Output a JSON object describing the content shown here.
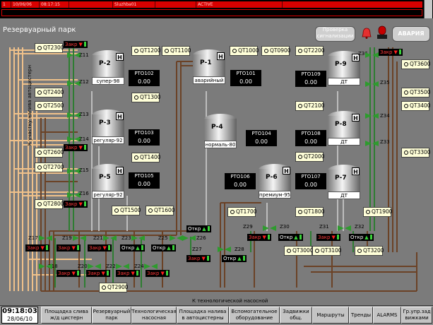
{
  "alarm_bar": {
    "row": [
      "1",
      "10/06/06",
      "08:17:15",
      "",
      "Sluzhba01",
      "",
      "ACTIVE",
      ""
    ]
  },
  "title": "Резервуарный парк",
  "buttons": {
    "reset": "Проверка сигнализации",
    "alarm": "АВАРИЯ"
  },
  "side_label": "К участку налива автоцистерн",
  "bottom_label": "К технологической насосной",
  "tanks": [
    {
      "name": "Р-2",
      "label": "супер-98"
    },
    {
      "name": "Р-3",
      "label": "регуляр-92"
    },
    {
      "name": "Р-5",
      "label": "регуляр-92"
    },
    {
      "name": "Р-1",
      "label": "аварийный"
    },
    {
      "name": "Р-4",
      "label": "нормаль-80"
    },
    {
      "name": "Р-6",
      "label": "премиум-95"
    },
    {
      "name": "Р-9",
      "label": "ДТ"
    },
    {
      "name": "Р-8",
      "label": "ДТ"
    },
    {
      "name": "Р-7",
      "label": "ДТ"
    }
  ],
  "tank_h": "Н",
  "rto": [
    {
      "name": "РТО102",
      "value": "0.00"
    },
    {
      "name": "РТО103",
      "value": "0.00"
    },
    {
      "name": "РТО105",
      "value": "0.00"
    },
    {
      "name": "РТО101",
      "value": "0.00"
    },
    {
      "name": "РТО104",
      "value": "0.00"
    },
    {
      "name": "РТО106",
      "value": "0.00"
    },
    {
      "name": "РТО109",
      "value": "0.00"
    },
    {
      "name": "РТО108",
      "value": "0.00"
    },
    {
      "name": "РТО107",
      "value": "0.00"
    }
  ],
  "qt": [
    "QT2300",
    "QT2400",
    "QT2500",
    "QT2600",
    "QT2700",
    "QT2800",
    "QT1200",
    "QT1100",
    "QT1000",
    "QT0900",
    "QT2200",
    "QT1300",
    "QT1400",
    "QT1500",
    "QT1600",
    "QT2100",
    "QT2000",
    "QT1700",
    "QT1800",
    "QT1900",
    "QT3600",
    "QT3500",
    "QT3400",
    "QT3300",
    "QT3000",
    "QT3100",
    "QT3200",
    "QT2900"
  ],
  "z": [
    "Z11",
    "Z12",
    "Z13",
    "Z14",
    "Z15",
    "Z16",
    "Z36",
    "Z35",
    "Z34",
    "Z33",
    "Z17",
    "Z18",
    "Z19",
    "Z21",
    "Z20",
    "Z22",
    "Z23",
    "Z24",
    "Z25",
    "Z26",
    "Z27",
    "Z28",
    "Z29",
    "Z30",
    "Z31",
    "Z32"
  ],
  "status": {
    "closed": "Закр",
    "open": "Откр"
  },
  "nav": {
    "time": "09:18:03",
    "date": "28/06/10",
    "items": [
      "Площадка слива ж/д цистерн",
      "Резервуарный парк",
      "Технологическая насосная",
      "Площадка налива в автоцистерны",
      "Вспомогательное оборудование",
      "Задвижки общ.",
      "Маршруты",
      "Тренды",
      "ALARMS",
      "Гр.упр.зад вижками"
    ]
  },
  "colors": {
    "pipe_light": "#f0c18a",
    "pipe_brown": "#6b4226",
    "pipe_green": "#2e7d32",
    "valve": "#2e9b2e",
    "closed": "#ff1e1e",
    "open": "#3ad33a"
  }
}
